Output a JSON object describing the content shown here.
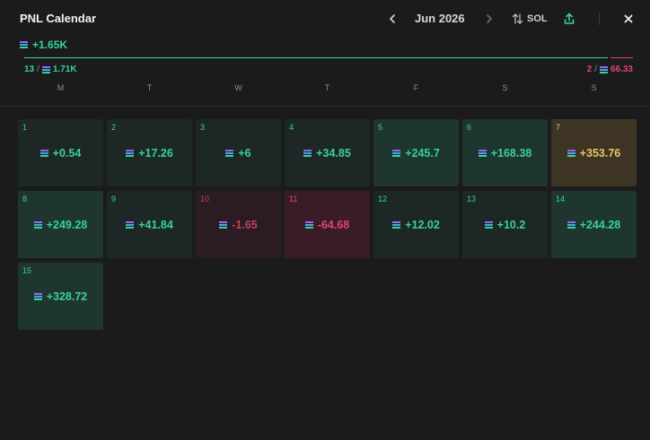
{
  "header": {
    "title": "PNL Calendar",
    "month": "Jun 2026",
    "currency": "SOL"
  },
  "summary": {
    "total": "+1.65K",
    "wins_count": "13",
    "wins_amount": "1.71K",
    "losses_count": "2",
    "losses_amount": "66.33",
    "win_fraction": 0.96
  },
  "weekdays": [
    "M",
    "T",
    "W",
    "T",
    "F",
    "S",
    "S"
  ],
  "colors": {
    "positive": "#36d39a",
    "negative": "#e0446d",
    "best": "#eac26c"
  },
  "days": [
    {
      "day": "1",
      "pnl": "+0.54",
      "tone": "g1"
    },
    {
      "day": "2",
      "pnl": "+17.26",
      "tone": "g1"
    },
    {
      "day": "3",
      "pnl": "+6",
      "tone": "g1"
    },
    {
      "day": "4",
      "pnl": "+34.85",
      "tone": "g1"
    },
    {
      "day": "5",
      "pnl": "+245.7",
      "tone": "g2"
    },
    {
      "day": "6",
      "pnl": "+168.38",
      "tone": "g2"
    },
    {
      "day": "7",
      "pnl": "+353.76",
      "tone": "gold"
    },
    {
      "day": "8",
      "pnl": "+249.28",
      "tone": "g2"
    },
    {
      "day": "9",
      "pnl": "+41.84",
      "tone": "g1"
    },
    {
      "day": "10",
      "pnl": "-1.65",
      "tone": "r1"
    },
    {
      "day": "11",
      "pnl": "-64.68",
      "tone": "r2"
    },
    {
      "day": "12",
      "pnl": "+12.02",
      "tone": "g1"
    },
    {
      "day": "13",
      "pnl": "+10.2",
      "tone": "g1"
    },
    {
      "day": "14",
      "pnl": "+244.28",
      "tone": "g2"
    },
    {
      "day": "15",
      "pnl": "+328.72",
      "tone": "g2"
    }
  ]
}
